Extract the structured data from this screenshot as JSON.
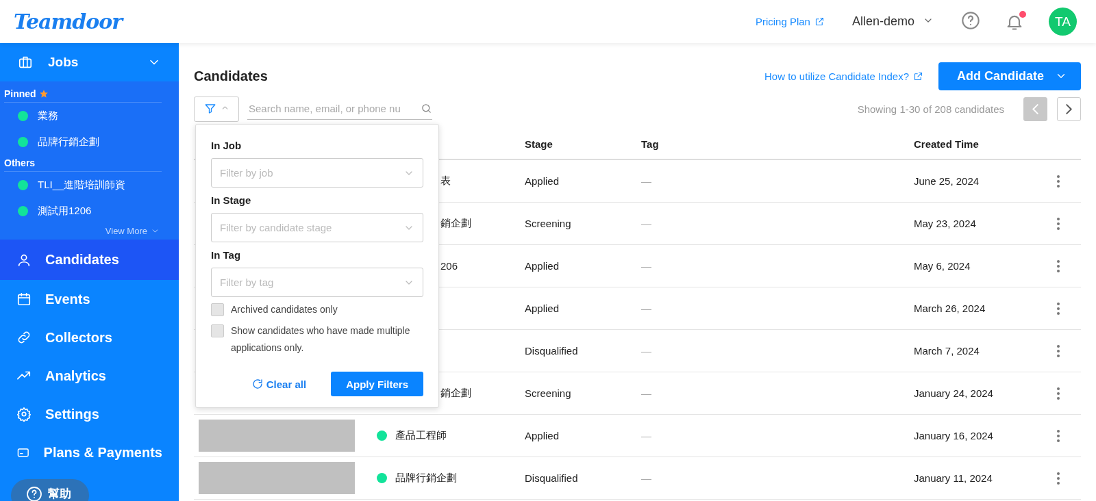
{
  "header": {
    "logo": "Teamdoor",
    "pricing_link": "Pricing Plan",
    "account": "Allen-demo",
    "notifications_unread": true,
    "avatar": "TA"
  },
  "sidebar": {
    "jobs": {
      "label": "Jobs",
      "expanded": true
    },
    "groups": [
      {
        "title": "Pinned",
        "starred": true,
        "items": [
          {
            "label": "業務",
            "color": "#12e39a"
          },
          {
            "label": "品牌行銷企劃",
            "color": "#12e39a"
          }
        ]
      },
      {
        "title": "Others",
        "starred": false,
        "items": [
          {
            "label": "TLI__進階培訓師資",
            "color": "#12e39a"
          },
          {
            "label": "測試用1206",
            "color": "#12e39a"
          }
        ]
      }
    ],
    "view_more": "View More",
    "nav": [
      {
        "label": "Candidates",
        "selected": true
      },
      {
        "label": "Events",
        "selected": false
      },
      {
        "label": "Collectors",
        "selected": false
      },
      {
        "label": "Analytics",
        "selected": false
      },
      {
        "label": "Settings",
        "selected": false
      },
      {
        "label": "Plans & Payments",
        "selected": false
      }
    ],
    "help": "幫助"
  },
  "page": {
    "title": "Candidates",
    "help_link": "How to utilize Candidate Index?",
    "add_button": "Add Candidate",
    "search": {
      "placeholder": "Search name, email, or phone nu"
    },
    "filter_open": true,
    "pagination": {
      "summary": "Showing 1-30 of 208 candidates",
      "prev_disabled": true,
      "next_disabled": false
    }
  },
  "filter_popup": {
    "fields": [
      {
        "label": "In Job",
        "placeholder": "Filter by job"
      },
      {
        "label": "In Stage",
        "placeholder": "Filter by candidate stage"
      },
      {
        "label": "In Tag",
        "placeholder": "Filter by tag"
      }
    ],
    "checkboxes": [
      {
        "label": "Archived candidates only",
        "checked": false
      },
      {
        "label": "Show candidates who have made multiple applications only.",
        "checked": false
      }
    ],
    "clear": "Clear all",
    "apply": "Apply Filters"
  },
  "table": {
    "columns": [
      "Stage",
      "Tag",
      "Created Time"
    ],
    "rows": [
      {
        "kind": "partial",
        "job": "表",
        "stage": "Applied",
        "tag": "—",
        "created": "June 25, 2024"
      },
      {
        "kind": "partial",
        "job": "銷企劃",
        "stage": "Screening",
        "tag": "—",
        "created": "May 23, 2024"
      },
      {
        "kind": "partial",
        "job": "206",
        "stage": "Applied",
        "tag": "—",
        "created": "May 6, 2024"
      },
      {
        "kind": "partial",
        "stage": "Applied",
        "tag": "—",
        "created": "March 26, 2024"
      },
      {
        "kind": "partial",
        "stage": "Disqualified",
        "tag": "—",
        "created": "March 7, 2024"
      },
      {
        "kind": "partial",
        "job": "銷企劃",
        "stage": "Screening",
        "tag": "—",
        "created": "January 24, 2024"
      },
      {
        "kind": "full",
        "job": "產品工程師",
        "color": "#12e39a",
        "stage": "Applied",
        "tag": "—",
        "created": "January 16, 2024"
      },
      {
        "kind": "full",
        "job": "品牌行銷企劃",
        "color": "#12e39a",
        "stage": "Disqualified",
        "tag": "—",
        "created": "January 11, 2024"
      }
    ]
  }
}
